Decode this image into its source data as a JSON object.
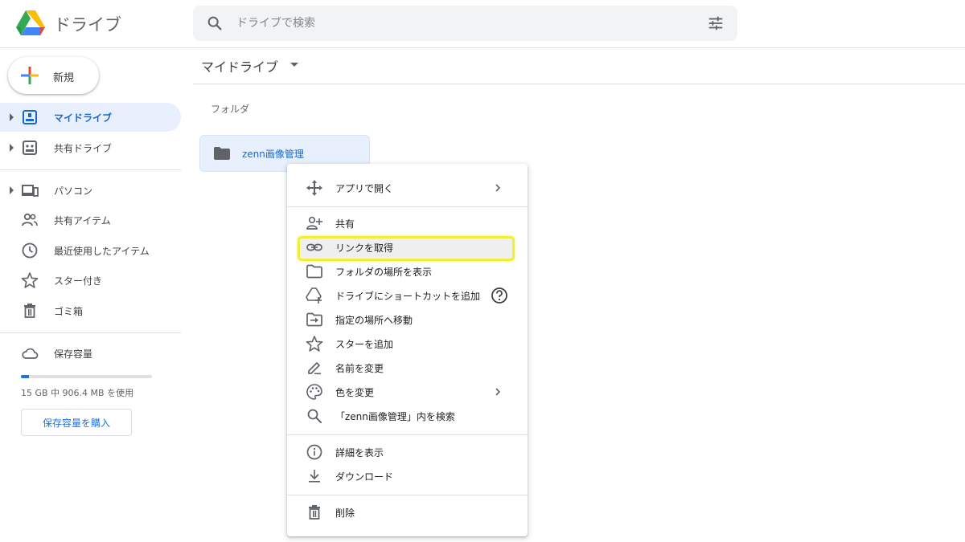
{
  "app": {
    "title": "ドライブ"
  },
  "search": {
    "placeholder": "ドライブで検索"
  },
  "sidebar": {
    "new_label": "新規",
    "items": [
      {
        "label": "マイドライブ",
        "icon": "my-drive-icon"
      },
      {
        "label": "共有ドライブ",
        "icon": "shared-drives-icon"
      },
      {
        "label": "パソコン",
        "icon": "computers-icon"
      },
      {
        "label": "共有アイテム",
        "icon": "shared-with-me-icon"
      },
      {
        "label": "最近使用したアイテム",
        "icon": "recent-icon"
      },
      {
        "label": "スター付き",
        "icon": "star-icon"
      },
      {
        "label": "ゴミ箱",
        "icon": "trash-icon"
      }
    ],
    "storage": {
      "label": "保存容量",
      "usage_text": "15 GB 中 906.4 MB を使用",
      "used_fraction": 0.059,
      "buy_label": "保存容量を購入"
    }
  },
  "main": {
    "breadcrumb": "マイドライブ",
    "section_label": "フォルダ",
    "folder": {
      "name": "zenn画像管理"
    }
  },
  "context_menu": {
    "items": [
      {
        "label": "アプリで開く",
        "icon": "open-with-icon",
        "submenu": true
      },
      {
        "label": "共有",
        "icon": "share-person-icon"
      },
      {
        "label": "リンクを取得",
        "icon": "link-icon",
        "highlighted": true
      },
      {
        "label": "フォルダの場所を表示",
        "icon": "folder-outline-icon"
      },
      {
        "label": "ドライブにショートカットを追加",
        "icon": "add-shortcut-icon",
        "help": true
      },
      {
        "label": "指定の場所へ移動",
        "icon": "move-to-icon"
      },
      {
        "label": "スターを追加",
        "icon": "star-outline-icon"
      },
      {
        "label": "名前を変更",
        "icon": "rename-icon"
      },
      {
        "label": "色を変更",
        "icon": "palette-icon",
        "submenu": true
      },
      {
        "label": "「zenn画像管理」内を検索",
        "icon": "search-icon"
      },
      {
        "label": "詳細を表示",
        "icon": "info-icon"
      },
      {
        "label": "ダウンロード",
        "icon": "download-icon"
      },
      {
        "label": "削除",
        "icon": "trash-icon"
      }
    ]
  },
  "colors": {
    "accent": "#1a73e8",
    "active_bg": "#e8f0fe",
    "highlight_border": "#f2ee37"
  }
}
